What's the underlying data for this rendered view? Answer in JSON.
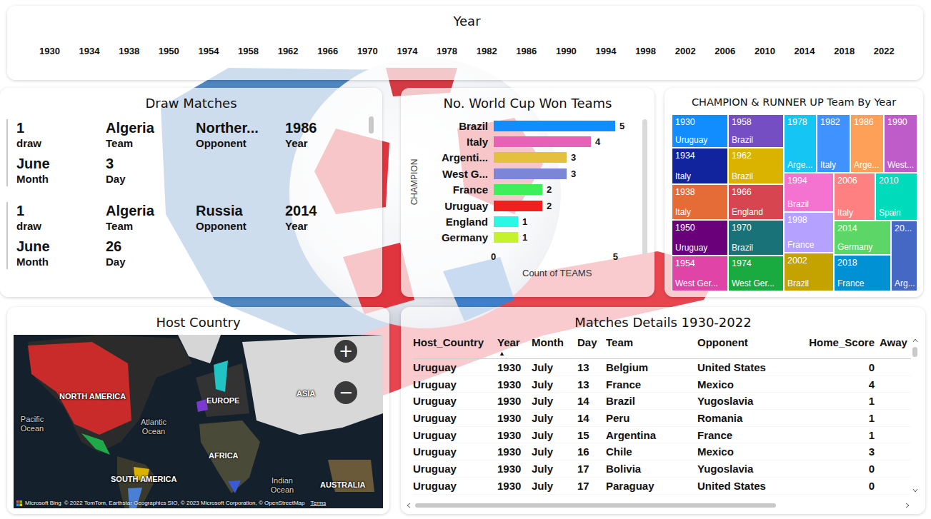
{
  "year_slicer": {
    "title": "Year",
    "years": [
      "1930",
      "1934",
      "1938",
      "1950",
      "1954",
      "1958",
      "1962",
      "1966",
      "1970",
      "1974",
      "1978",
      "1982",
      "1986",
      "1990",
      "1994",
      "1998",
      "2002",
      "2006",
      "2010",
      "2014",
      "2018",
      "2022"
    ]
  },
  "draw_matches": {
    "title": "Draw Matches",
    "cards": [
      {
        "fields": [
          {
            "value": "1",
            "label": "draw"
          },
          {
            "value": "Algeria",
            "label": "Team"
          },
          {
            "value": "Norther...",
            "label": "Opponent"
          },
          {
            "value": "1986",
            "label": "Year"
          },
          {
            "value": "June",
            "label": "Month"
          },
          {
            "value": "3",
            "label": "Day"
          }
        ]
      },
      {
        "fields": [
          {
            "value": "1",
            "label": "draw"
          },
          {
            "value": "Algeria",
            "label": "Team"
          },
          {
            "value": "Russia",
            "label": "Opponent"
          },
          {
            "value": "2014",
            "label": "Year"
          },
          {
            "value": "June",
            "label": "Month"
          },
          {
            "value": "26",
            "label": "Day"
          }
        ]
      }
    ]
  },
  "wins_chart": {
    "title": "No. World Cup Won Teams",
    "y_axis_title": "CHAMPION",
    "x_axis_title": "Count of TEAMS",
    "ticks": [
      "0",
      "5"
    ],
    "bars": [
      {
        "label": "Brazil",
        "value": 5,
        "value_label": "5",
        "color": "#118DFF"
      },
      {
        "label": "Italy",
        "value": 4,
        "value_label": "4",
        "color": "#E762B6"
      },
      {
        "label": "Argenti...",
        "value": 3,
        "value_label": "3",
        "color": "#E3C13F"
      },
      {
        "label": "West G...",
        "value": 3,
        "value_label": "3",
        "color": "#7C86D6"
      },
      {
        "label": "France",
        "value": 2,
        "value_label": "2",
        "color": "#3DF05A"
      },
      {
        "label": "Uruguay",
        "value": 2,
        "value_label": "2",
        "color": "#F0201F"
      },
      {
        "label": "England",
        "value": 1,
        "value_label": "1",
        "color": "#2DF7E4"
      },
      {
        "label": "Germany",
        "value": 1,
        "value_label": "1",
        "color": "#C4F32E"
      }
    ]
  },
  "treemap": {
    "title": "CHAMPION & RUNNER UP Team By Year",
    "tiles": [
      {
        "year": "1930",
        "team": "Uruguay",
        "color": "#118DFF"
      },
      {
        "year": "1934",
        "team": "Italy",
        "color": "#12239E"
      },
      {
        "year": "1938",
        "team": "Italy",
        "color": "#E66C37"
      },
      {
        "year": "1950",
        "team": "Uruguay",
        "color": "#6B007B"
      },
      {
        "year": "1954",
        "team": "West Ger...",
        "color": "#E044A7"
      },
      {
        "year": "1958",
        "team": "Brazil",
        "color": "#744EC2"
      },
      {
        "year": "1962",
        "team": "Brazil",
        "color": "#D9B300"
      },
      {
        "year": "1966",
        "team": "England",
        "color": "#D64550"
      },
      {
        "year": "1970",
        "team": "Brazil",
        "color": "#197278"
      },
      {
        "year": "1974",
        "team": "West Ger...",
        "color": "#1AAB40"
      },
      {
        "year": "1978",
        "team": "Arge...",
        "color": "#15C6F4"
      },
      {
        "year": "1982",
        "team": "Italy",
        "color": "#4092FF"
      },
      {
        "year": "1986",
        "team": "Arge...",
        "color": "#FFA058"
      },
      {
        "year": "1990",
        "team": "West...",
        "color": "#BE5DC9"
      },
      {
        "year": "1994",
        "team": "Brazil",
        "color": "#F472D0"
      },
      {
        "year": "1998",
        "team": "France",
        "color": "#B5A1FF"
      },
      {
        "year": "2002",
        "team": "Brazil",
        "color": "#C4A200"
      },
      {
        "year": "2006",
        "team": "Italy",
        "color": "#FF8080"
      },
      {
        "year": "2010",
        "team": "Spain",
        "color": "#00DBBC"
      },
      {
        "year": "2014",
        "team": "Germany",
        "color": "#5BD667"
      },
      {
        "year": "2018",
        "team": "France",
        "color": "#0091D5"
      },
      {
        "year": "20...",
        "team": "Arg...",
        "color": "#4668C5"
      }
    ]
  },
  "host_map": {
    "title": "Host Country",
    "labels": [
      {
        "text": "NORTH AMERICA",
        "kind": "continent"
      },
      {
        "text": "EUROPE",
        "kind": "continent"
      },
      {
        "text": "ASIA",
        "kind": "continent"
      },
      {
        "text": "Pacific Ocean",
        "kind": "ocean"
      },
      {
        "text": "Atlantic Ocean",
        "kind": "ocean"
      },
      {
        "text": "AFRICA",
        "kind": "continent"
      },
      {
        "text": "SOUTH AMERICA",
        "kind": "continent"
      },
      {
        "text": "Indian Ocean",
        "kind": "ocean"
      },
      {
        "text": "AUSTRALIA",
        "kind": "continent"
      }
    ],
    "zoom_in": "+",
    "zoom_out": "−",
    "brand": "Microsoft Bing",
    "attribution": "© 2022 TomTom, Earthstar Geographics SIO, © 2023 Microsoft Corporation, © OpenStreetMap",
    "terms": "Terms"
  },
  "matches_table": {
    "title": "Matches Details 1930-2022",
    "sort_icon": "▲",
    "columns": [
      {
        "label": "Host_Country",
        "sorted": false
      },
      {
        "label": "Year",
        "sorted": true
      },
      {
        "label": "Month",
        "sorted": false
      },
      {
        "label": "Day",
        "sorted": false
      },
      {
        "label": "Team",
        "sorted": false
      },
      {
        "label": "Opponent",
        "sorted": false
      },
      {
        "label": "Home_Score",
        "sorted": false
      },
      {
        "label": "Away",
        "sorted": false
      }
    ],
    "rows": [
      [
        "Uruguay",
        "1930",
        "July",
        "13",
        "Belgium",
        "United States",
        "0"
      ],
      [
        "Uruguay",
        "1930",
        "July",
        "13",
        "France",
        "Mexico",
        "4"
      ],
      [
        "Uruguay",
        "1930",
        "July",
        "14",
        "Brazil",
        "Yugoslavia",
        "1"
      ],
      [
        "Uruguay",
        "1930",
        "July",
        "14",
        "Peru",
        "Romania",
        "1"
      ],
      [
        "Uruguay",
        "1930",
        "July",
        "15",
        "Argentina",
        "France",
        "1"
      ],
      [
        "Uruguay",
        "1930",
        "July",
        "16",
        "Chile",
        "Mexico",
        "3"
      ],
      [
        "Uruguay",
        "1930",
        "July",
        "17",
        "Bolivia",
        "Yugoslavia",
        "0"
      ],
      [
        "Uruguay",
        "1930",
        "July",
        "17",
        "Paraguay",
        "United States",
        "0"
      ]
    ]
  }
}
